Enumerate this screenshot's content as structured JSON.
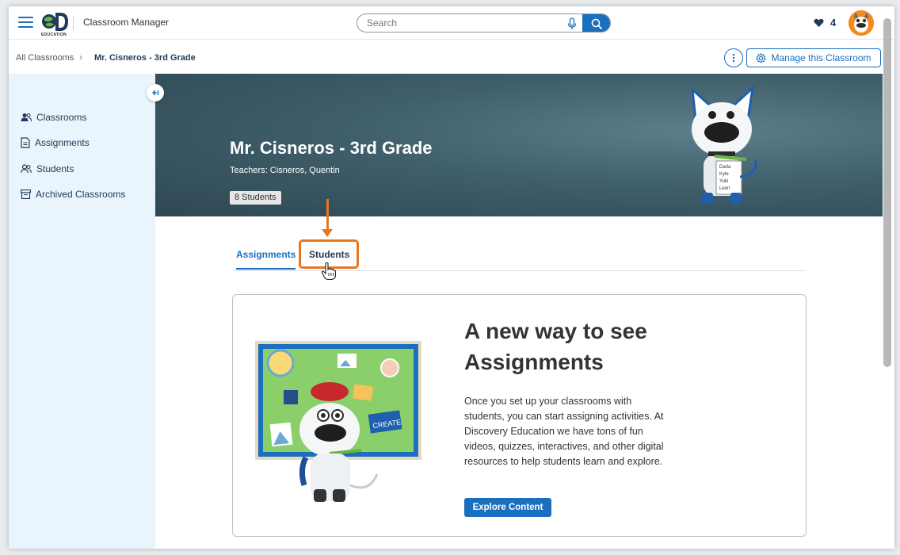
{
  "header": {
    "logo_text": "EDUCATION",
    "app_title": "Classroom Manager",
    "search_placeholder": "Search",
    "favorites_count": "4"
  },
  "breadcrumb": {
    "home": "All Classrooms",
    "separator": "›",
    "current": "Mr. Cisneros - 3rd Grade"
  },
  "actions": {
    "manage_label": "Manage this Classroom"
  },
  "sidebar": {
    "items": [
      {
        "label": "Classrooms",
        "icon": "classrooms-icon"
      },
      {
        "label": "Assignments",
        "icon": "assignments-icon"
      },
      {
        "label": "Students",
        "icon": "students-icon"
      },
      {
        "label": "Archived Classrooms",
        "icon": "archive-icon"
      }
    ]
  },
  "hero": {
    "title": "Mr. Cisneros - 3rd Grade",
    "teachers": "Teachers: Cisneros, Quentin",
    "student_count": "8 Students",
    "checklist": [
      "Darla",
      "Kyle",
      "Yuki",
      "Leon"
    ]
  },
  "tabs": [
    {
      "label": "Assignments",
      "active": true
    },
    {
      "label": "Students",
      "active": false
    }
  ],
  "card": {
    "heading": "A new way to see Assignments",
    "body": "Once you set up your classrooms with students, you can start assigning activities. At Discovery Education we have tons of fun videos, quizzes, interactives, and other digital resources to help students learn and explore.",
    "button_label": "Explore Content",
    "board_label": "CREATE"
  },
  "colors": {
    "brand_blue": "#1a6fbf",
    "sidebar_bg": "#e9f4fc",
    "highlight_orange": "#e87722",
    "navy_text": "#1f3a5a"
  }
}
